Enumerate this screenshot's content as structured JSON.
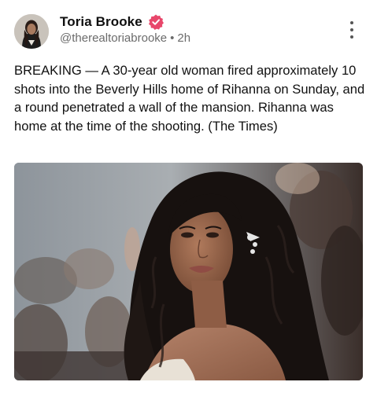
{
  "post": {
    "author": {
      "display_name": "Toria Brooke",
      "handle": "@therealtoriabrooke",
      "separator": "•",
      "timestamp": "2h",
      "verified_icon": "verified-badge-icon",
      "badge_color": "#e8476b"
    },
    "body_text": "BREAKING — A 30-year old woman fired approximately 10 shots into the Beverly Hills home of Rihanna on Sunday, and a round penetrated a wall of the mansion. Rihanna was home at the time of the shooting. (The Times)",
    "media": {
      "kind": "photo"
    },
    "menu_icon": "more-vertical-icon"
  }
}
